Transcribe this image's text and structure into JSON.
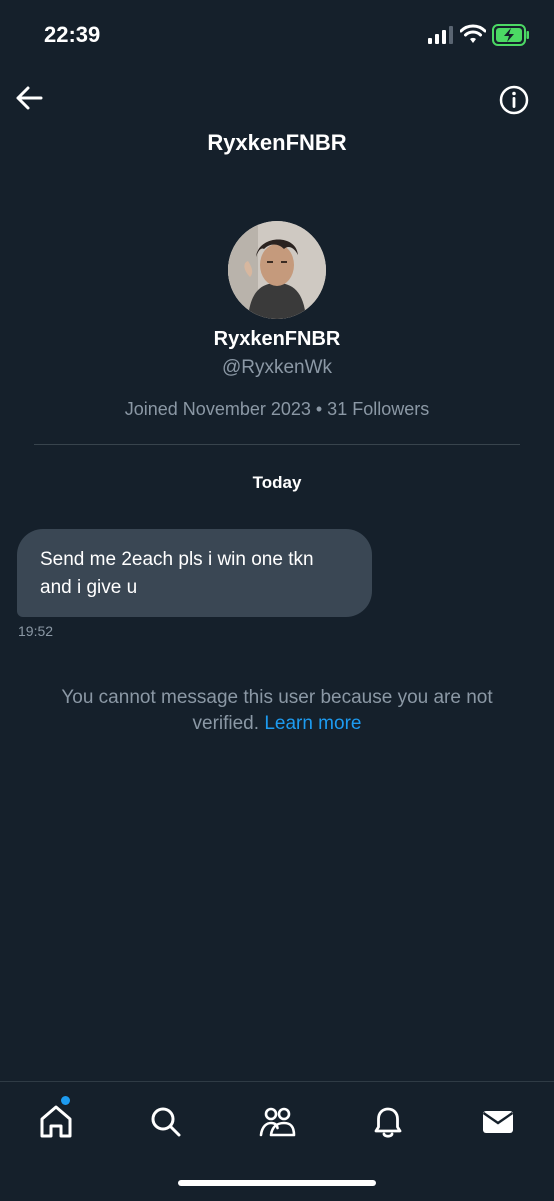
{
  "status": {
    "time": "22:39",
    "icons": [
      "cellular-signal-icon",
      "wifi-icon",
      "battery-charging-icon"
    ]
  },
  "header": {
    "title": "RyxkenFNBR",
    "icons": [
      "back-arrow-icon",
      "info-icon"
    ]
  },
  "profile": {
    "name": "RyxkenFNBR",
    "handle": "@RyxkenWk",
    "meta": "Joined November 2023 • 31 Followers"
  },
  "conversation": {
    "date_separator": "Today",
    "messages": [
      {
        "text": "Send me 2each pls i win one tkn and i give u",
        "time": "19:52"
      }
    ],
    "notice": {
      "text": "You cannot message this user because you are not verified.",
      "link": "Learn more"
    }
  },
  "tab_bar": {
    "items": [
      "home-icon",
      "search-icon",
      "communities-icon",
      "notifications-icon",
      "messages-icon"
    ],
    "active": "messages-icon",
    "unread_dot": "home-icon"
  },
  "colors": {
    "background": "#15202b",
    "bubble": "#3a4754",
    "secondary_text": "#8b98a5",
    "link": "#1d9bf0",
    "battery": "#4cd964"
  }
}
